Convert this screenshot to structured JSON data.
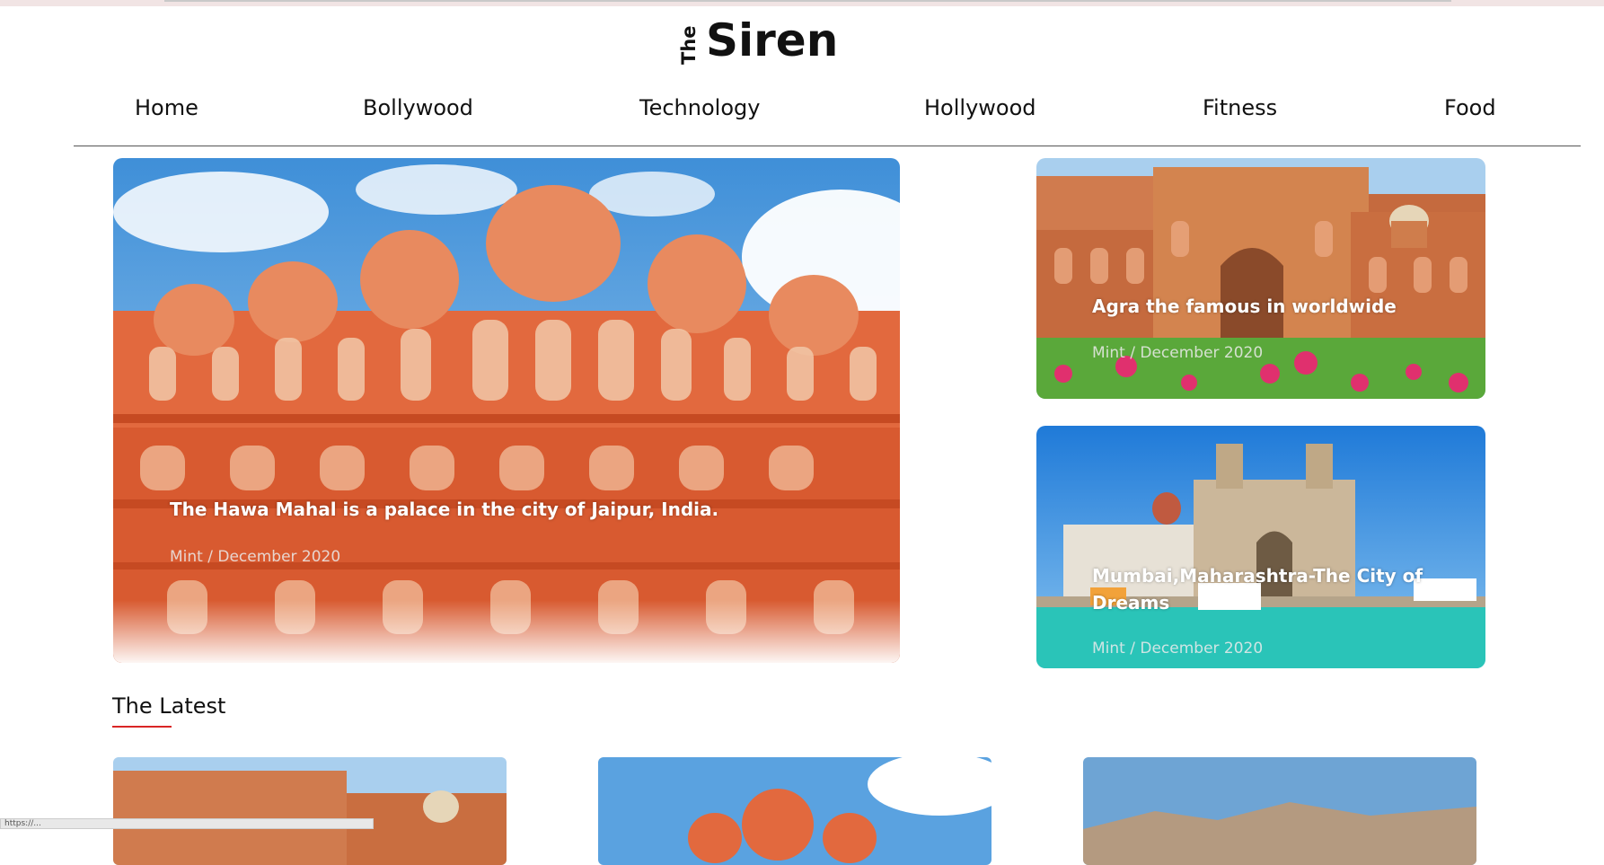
{
  "site": {
    "logo_the": "The",
    "logo_name": "Siren"
  },
  "nav": {
    "items": [
      {
        "label": "Home"
      },
      {
        "label": "Bollywood"
      },
      {
        "label": "Technology"
      },
      {
        "label": "Hollywood"
      },
      {
        "label": "Fitness"
      },
      {
        "label": "Food"
      }
    ]
  },
  "featured": {
    "main": {
      "title": "The Hawa Mahal is a palace in the city of Jaipur, India.",
      "meta": "Mint / December 2020"
    },
    "side": [
      {
        "title": "Agra the famous in worldwide",
        "meta": "Mint / December 2020"
      },
      {
        "title": "Mumbai,Maharashtra-The City of Dreams",
        "meta": "Mint / December 2020"
      }
    ]
  },
  "latest": {
    "heading": "The Latest",
    "accent_color": "#d92525"
  },
  "statusbar": {
    "url": "https://..."
  }
}
